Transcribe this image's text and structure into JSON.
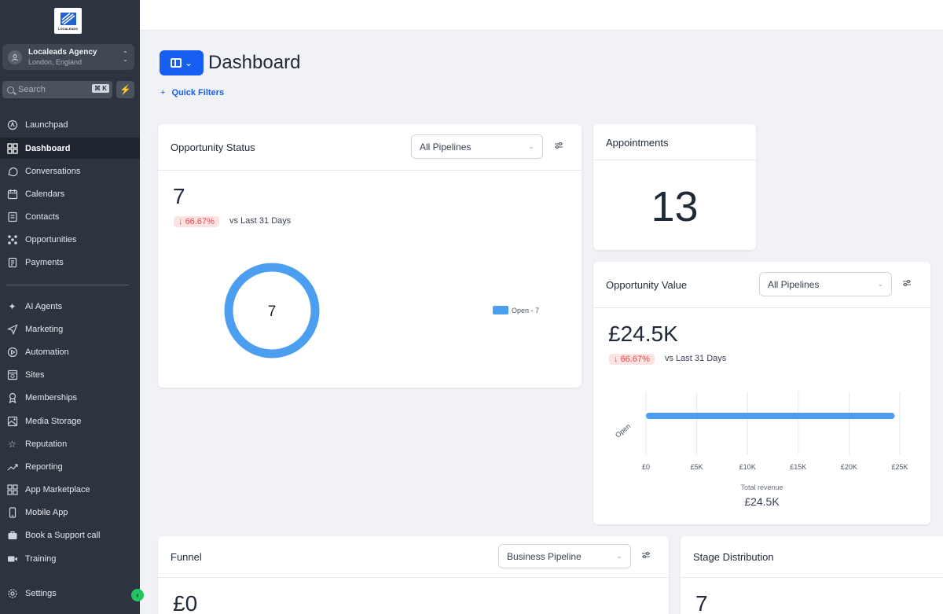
{
  "sidebar": {
    "logo_text": "LOCALEADS",
    "account": {
      "name": "Localeads Agency",
      "location": "London, England"
    },
    "search": {
      "placeholder": "Search",
      "shortcut": "⌘ K"
    },
    "items": [
      {
        "label": "Launchpad",
        "icon": "rocket-icon"
      },
      {
        "label": "Dashboard",
        "icon": "grid-icon",
        "active": true
      },
      {
        "label": "Conversations",
        "icon": "chat-icon"
      },
      {
        "label": "Calendars",
        "icon": "calendar-icon"
      },
      {
        "label": "Contacts",
        "icon": "contacts-icon"
      },
      {
        "label": "Opportunities",
        "icon": "opportunities-icon"
      },
      {
        "label": "Payments",
        "icon": "payments-icon"
      },
      {
        "label": "AI Agents",
        "icon": "sparkle-icon"
      },
      {
        "label": "Marketing",
        "icon": "send-icon"
      },
      {
        "label": "Automation",
        "icon": "automation-icon"
      },
      {
        "label": "Sites",
        "icon": "sites-icon"
      },
      {
        "label": "Memberships",
        "icon": "membership-icon"
      },
      {
        "label": "Media Storage",
        "icon": "image-icon"
      },
      {
        "label": "Reputation",
        "icon": "star-icon"
      },
      {
        "label": "Reporting",
        "icon": "trend-icon"
      },
      {
        "label": "App Marketplace",
        "icon": "apps-icon"
      },
      {
        "label": "Mobile App",
        "icon": "mobile-icon"
      },
      {
        "label": "Book a Support call",
        "icon": "briefcase-icon"
      },
      {
        "label": "Training",
        "icon": "video-icon"
      },
      {
        "label": "Settings",
        "icon": "gear-icon"
      }
    ]
  },
  "header": {
    "title": "Dashboard",
    "quick_filters": "Quick Filters"
  },
  "opportunity_status": {
    "title": "Opportunity Status",
    "pipeline": "All Pipelines",
    "count": "7",
    "change": "66.67%",
    "vs": "vs Last 31 Days",
    "donut_center": "7",
    "legend": "Open - 7"
  },
  "appointments": {
    "title": "Appointments",
    "count": "13"
  },
  "opportunity_value": {
    "title": "Opportunity Value",
    "pipeline": "All Pipelines",
    "value": "£24.5K",
    "change": "66.67%",
    "vs": "vs Last 31 Days",
    "total_label": "Total revenue",
    "total_value": "£24.5K"
  },
  "funnel": {
    "title": "Funnel",
    "pipeline": "Business Pipeline",
    "value": "£0"
  },
  "stage_distribution": {
    "title": "Stage Distribution",
    "value": "7"
  },
  "colors": {
    "accent": "#155eef",
    "series": "#4c9ff0",
    "negative": "#e5484d"
  },
  "chart_data": {
    "type": "bar",
    "orientation": "horizontal",
    "categories": [
      "Open"
    ],
    "values": [
      24.5
    ],
    "x_ticks": [
      "£0",
      "£5K",
      "£10K",
      "£15K",
      "£20K",
      "£25K"
    ],
    "xlim": [
      0,
      25
    ],
    "grid": true
  }
}
